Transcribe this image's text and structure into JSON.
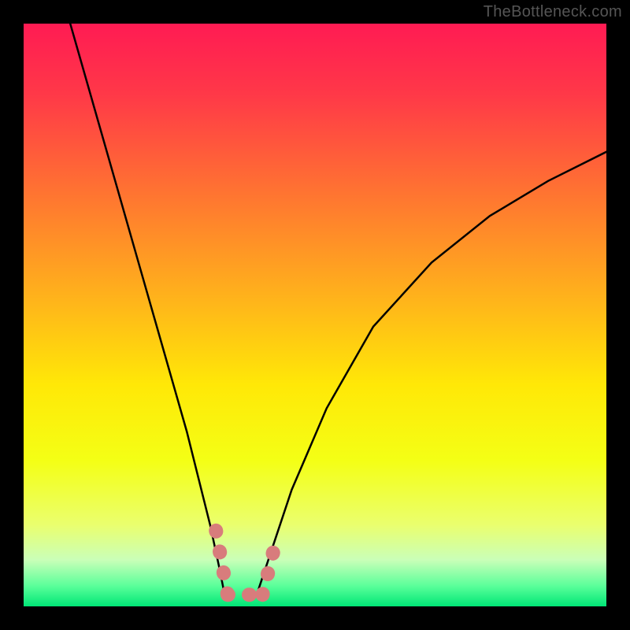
{
  "watermark": "TheBottleneck.com",
  "chart_data": {
    "type": "line",
    "title": "",
    "xlabel": "",
    "ylabel": "",
    "xlim": [
      0,
      100
    ],
    "ylim": [
      0,
      100
    ],
    "gradient_stops": [
      {
        "pos": 0.0,
        "color": "#ff1b53"
      },
      {
        "pos": 0.12,
        "color": "#ff3848"
      },
      {
        "pos": 0.3,
        "color": "#ff7730"
      },
      {
        "pos": 0.48,
        "color": "#ffb61a"
      },
      {
        "pos": 0.62,
        "color": "#ffe807"
      },
      {
        "pos": 0.75,
        "color": "#f4ff15"
      },
      {
        "pos": 0.86,
        "color": "#eaff6e"
      },
      {
        "pos": 0.92,
        "color": "#caffb8"
      },
      {
        "pos": 0.965,
        "color": "#5aff9a"
      },
      {
        "pos": 1.0,
        "color": "#00e676"
      }
    ],
    "series": [
      {
        "name": "left-curve",
        "x": [
          8,
          12,
          16,
          20,
          24,
          28,
          30,
          32,
          33.5,
          34.5
        ],
        "y": [
          100,
          86,
          72,
          58,
          44,
          30,
          22,
          14,
          7,
          2
        ]
      },
      {
        "name": "right-curve",
        "x": [
          40,
          42,
          46,
          52,
          60,
          70,
          80,
          90,
          100
        ],
        "y": [
          2,
          8,
          20,
          34,
          48,
          59,
          67,
          73,
          78
        ]
      }
    ],
    "highlight": {
      "color": "#d87c7c",
      "segments": [
        {
          "x1": 33,
          "y1": 13,
          "x2": 35,
          "y2": 2
        },
        {
          "x1": 35,
          "y1": 2,
          "x2": 41,
          "y2": 2
        },
        {
          "x1": 41,
          "y1": 2,
          "x2": 43,
          "y2": 10
        }
      ]
    }
  }
}
